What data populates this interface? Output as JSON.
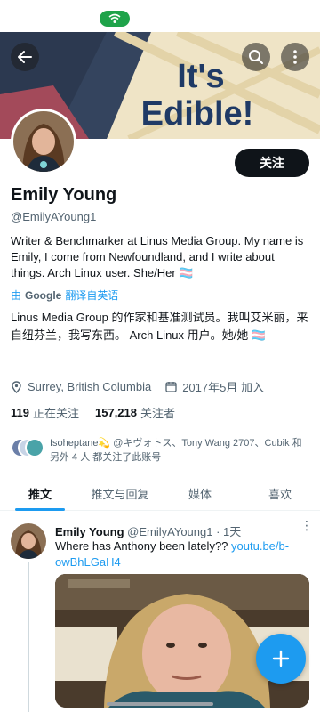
{
  "banner": {
    "text_line1": "It's",
    "text_line2": "Edible!"
  },
  "profile": {
    "name": "Emily Young",
    "handle": "@EmilyAYoung1",
    "follow_label": "关注",
    "bio": "Writer & Benchmarker at Linus Media Group. My name is Emily, I come from Newfoundland, and I write about things. Arch Linux user. She/Her 🏳️‍⚧️",
    "translate_prefix": "由",
    "translate_brand": "Google",
    "translate_label": "翻译自英语",
    "bio_translated": "Linus Media Group 的作家和基准测试员。我叫艾米丽，来自纽芬兰，我写东西。 Arch Linux 用户。她/她 🏳️‍⚧️",
    "location": "Surrey, British Columbia",
    "joined": "2017年5月 加入",
    "following_count": "119",
    "following_label": "正在关注",
    "followers_count": "157,218",
    "followers_label": "关注者",
    "followed_by": "Isoheptane💫 @キヴォトス、Tony Wang 2707、Cubik 和 另外 4 人 都关注了此账号"
  },
  "tabs": [
    {
      "label": "推文",
      "active": true
    },
    {
      "label": "推文与回复",
      "active": false
    },
    {
      "label": "媒体",
      "active": false
    },
    {
      "label": "喜欢",
      "active": false
    }
  ],
  "tweet": {
    "name": "Emily Young",
    "handle_time": "@EmilyAYoung1 · 1天",
    "text": "Where has Anthony been lately?? ",
    "link": "youtu.be/b-owBhLGaH4",
    "more": "⋮"
  },
  "colors": {
    "accent": "#1d9bf0",
    "status_pill": "#1fa34a",
    "text": "#0f1419",
    "muted": "#536471"
  },
  "icons": [
    "wifi-icon",
    "back-arrow-icon",
    "search-icon",
    "more-vertical-icon",
    "location-pin-icon",
    "calendar-icon",
    "plus-icon"
  ]
}
